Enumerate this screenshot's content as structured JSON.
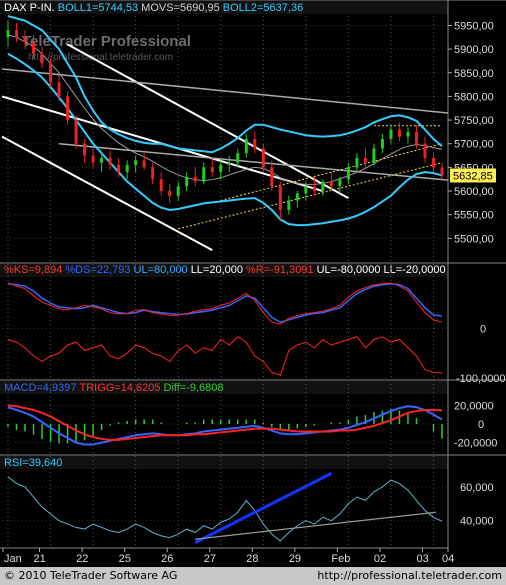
{
  "price_panel": {
    "header": [
      {
        "text": "DAX P-IN.",
        "color": "#ffffff"
      },
      {
        "text": "BOLL1=5744,53",
        "color": "#33ccff"
      },
      {
        "text": "MOVS=5690,95",
        "color": "#d0d0d0"
      },
      {
        "text": "BOLL2=5637,36",
        "color": "#33ccff"
      }
    ],
    "watermark_title": "TeleTrader Professional",
    "watermark_url": "http://professional.teletrader.com",
    "y_ticks": [
      "5950,00",
      "5900,00",
      "5850,00",
      "5800,00",
      "5750,00",
      "5700,00",
      "5650,00",
      "5600,00",
      "5550,00",
      "5500,00"
    ],
    "last_price": "5632,85"
  },
  "stoch_panel": {
    "header": [
      {
        "text": "%KS=9,894",
        "color": "#ff3333"
      },
      {
        "text": "%DS=22,793",
        "color": "#3366ff"
      },
      {
        "text": "UL=80,000",
        "color": "#33aaff"
      },
      {
        "text": "LL=20,000",
        "color": "#ffffff"
      },
      {
        "text": "%R=-91,3091",
        "color": "#ff3333"
      },
      {
        "text": "UL=-80,0000",
        "color": "#ffffff"
      },
      {
        "text": "LL=-20,0000",
        "color": "#ffffff"
      }
    ],
    "y_ticks": [
      "0",
      "-100,0000"
    ]
  },
  "macd_panel": {
    "header": [
      {
        "text": "MACD=4,9397",
        "color": "#3366ff"
      },
      {
        "text": "TRIGG=14,6205",
        "color": "#ff3333"
      },
      {
        "text": "Diff=-9,6808",
        "color": "#33cc33"
      }
    ],
    "y_ticks": [
      "20,0000",
      "0",
      "-20,0000"
    ]
  },
  "rsi_panel": {
    "header": [
      {
        "text": "RSI=39,640",
        "color": "#33ccff"
      }
    ],
    "y_ticks": [
      "60,000",
      "40,000"
    ]
  },
  "x_axis": {
    "ticks": [
      "Jan",
      "21",
      "22",
      "25",
      "26",
      "27",
      "28",
      "29",
      "Feb",
      "02",
      "03",
      "04"
    ]
  },
  "footer": {
    "copyright": "© 2010 TeleTrader Software AG",
    "url": "http://professional.teletrader.com"
  },
  "chart_data": [
    {
      "type": "candlestick",
      "title": "DAX P-IN.",
      "ylim": [
        5450,
        5970
      ],
      "candles": [
        {
          "o": 5925,
          "h": 5960,
          "l": 5905,
          "c": 5940
        },
        {
          "o": 5940,
          "h": 5955,
          "l": 5915,
          "c": 5925
        },
        {
          "o": 5925,
          "h": 5940,
          "l": 5900,
          "c": 5915
        },
        {
          "o": 5915,
          "h": 5930,
          "l": 5880,
          "c": 5890
        },
        {
          "o": 5890,
          "h": 5905,
          "l": 5860,
          "c": 5870
        },
        {
          "o": 5870,
          "h": 5880,
          "l": 5820,
          "c": 5830
        },
        {
          "o": 5830,
          "h": 5845,
          "l": 5790,
          "c": 5800
        },
        {
          "o": 5800,
          "h": 5810,
          "l": 5740,
          "c": 5750
        },
        {
          "o": 5750,
          "h": 5760,
          "l": 5690,
          "c": 5700
        },
        {
          "o": 5700,
          "h": 5710,
          "l": 5660,
          "c": 5675
        },
        {
          "o": 5675,
          "h": 5690,
          "l": 5650,
          "c": 5660
        },
        {
          "o": 5660,
          "h": 5680,
          "l": 5640,
          "c": 5670
        },
        {
          "o": 5670,
          "h": 5685,
          "l": 5645,
          "c": 5655
        },
        {
          "o": 5655,
          "h": 5670,
          "l": 5630,
          "c": 5640
        },
        {
          "o": 5640,
          "h": 5665,
          "l": 5625,
          "c": 5655
        },
        {
          "o": 5655,
          "h": 5675,
          "l": 5640,
          "c": 5665
        },
        {
          "o": 5665,
          "h": 5680,
          "l": 5645,
          "c": 5650
        },
        {
          "o": 5650,
          "h": 5660,
          "l": 5615,
          "c": 5625
        },
        {
          "o": 5625,
          "h": 5640,
          "l": 5590,
          "c": 5600
        },
        {
          "o": 5600,
          "h": 5615,
          "l": 5575,
          "c": 5590
        },
        {
          "o": 5590,
          "h": 5620,
          "l": 5580,
          "c": 5610
        },
        {
          "o": 5610,
          "h": 5640,
          "l": 5600,
          "c": 5630
        },
        {
          "o": 5630,
          "h": 5650,
          "l": 5610,
          "c": 5620
        },
        {
          "o": 5620,
          "h": 5660,
          "l": 5615,
          "c": 5650
        },
        {
          "o": 5650,
          "h": 5670,
          "l": 5630,
          "c": 5640
        },
        {
          "o": 5640,
          "h": 5665,
          "l": 5625,
          "c": 5655
        },
        {
          "o": 5655,
          "h": 5675,
          "l": 5640,
          "c": 5660
        },
        {
          "o": 5660,
          "h": 5690,
          "l": 5650,
          "c": 5680
        },
        {
          "o": 5680,
          "h": 5720,
          "l": 5670,
          "c": 5710
        },
        {
          "o": 5710,
          "h": 5725,
          "l": 5680,
          "c": 5690
        },
        {
          "o": 5690,
          "h": 5700,
          "l": 5640,
          "c": 5650
        },
        {
          "o": 5650,
          "h": 5665,
          "l": 5600,
          "c": 5610
        },
        {
          "o": 5610,
          "h": 5620,
          "l": 5540,
          "c": 5560
        },
        {
          "o": 5560,
          "h": 5590,
          "l": 5550,
          "c": 5580
        },
        {
          "o": 5580,
          "h": 5600,
          "l": 5565,
          "c": 5595
        },
        {
          "o": 5595,
          "h": 5620,
          "l": 5580,
          "c": 5610
        },
        {
          "o": 5610,
          "h": 5630,
          "l": 5590,
          "c": 5600
        },
        {
          "o": 5600,
          "h": 5625,
          "l": 5590,
          "c": 5620
        },
        {
          "o": 5620,
          "h": 5640,
          "l": 5600,
          "c": 5610
        },
        {
          "o": 5610,
          "h": 5630,
          "l": 5595,
          "c": 5625
        },
        {
          "o": 5625,
          "h": 5660,
          "l": 5615,
          "c": 5650
        },
        {
          "o": 5650,
          "h": 5680,
          "l": 5640,
          "c": 5670
        },
        {
          "o": 5670,
          "h": 5690,
          "l": 5650,
          "c": 5660
        },
        {
          "o": 5660,
          "h": 5700,
          "l": 5655,
          "c": 5690
        },
        {
          "o": 5690,
          "h": 5720,
          "l": 5680,
          "c": 5710
        },
        {
          "o": 5710,
          "h": 5740,
          "l": 5700,
          "c": 5730
        },
        {
          "o": 5730,
          "h": 5745,
          "l": 5705,
          "c": 5715
        },
        {
          "o": 5715,
          "h": 5735,
          "l": 5700,
          "c": 5725
        },
        {
          "o": 5725,
          "h": 5740,
          "l": 5690,
          "c": 5700
        },
        {
          "o": 5700,
          "h": 5715,
          "l": 5660,
          "c": 5670
        },
        {
          "o": 5670,
          "h": 5680,
          "l": 5640,
          "c": 5650
        },
        {
          "o": 5650,
          "h": 5660,
          "l": 5625,
          "c": 5633
        }
      ],
      "bollinger_upper": [
        5970,
        5965,
        5960,
        5950,
        5940,
        5920,
        5900,
        5870,
        5840,
        5800,
        5770,
        5745,
        5730,
        5720,
        5712,
        5706,
        5702,
        5700,
        5700,
        5695,
        5690,
        5688,
        5686,
        5684,
        5682,
        5690,
        5700,
        5712,
        5728,
        5740,
        5740,
        5735,
        5730,
        5726,
        5722,
        5718,
        5716,
        5715,
        5716,
        5718,
        5722,
        5728,
        5735,
        5745,
        5752,
        5758,
        5760,
        5756,
        5748,
        5730,
        5710,
        5695
      ],
      "moving_average": [
        5930,
        5925,
        5915,
        5905,
        5890,
        5870,
        5850,
        5825,
        5800,
        5775,
        5752,
        5732,
        5716,
        5702,
        5690,
        5680,
        5672,
        5663,
        5652,
        5642,
        5634,
        5628,
        5624,
        5622,
        5624,
        5628,
        5634,
        5640,
        5646,
        5650,
        5648,
        5640,
        5628,
        5620,
        5616,
        5614,
        5614,
        5616,
        5620,
        5626,
        5632,
        5640,
        5648,
        5658,
        5668,
        5678,
        5688,
        5695,
        5698,
        5696,
        5692,
        5688
      ],
      "bollinger_lower": [
        5890,
        5880,
        5868,
        5855,
        5840,
        5820,
        5798,
        5775,
        5750,
        5725,
        5700,
        5680,
        5660,
        5640,
        5620,
        5605,
        5590,
        5575,
        5565,
        5560,
        5562,
        5566,
        5570,
        5574,
        5576,
        5578,
        5580,
        5582,
        5584,
        5585,
        5575,
        5560,
        5540,
        5530,
        5528,
        5528,
        5530,
        5532,
        5535,
        5538,
        5542,
        5548,
        5556,
        5566,
        5578,
        5590,
        5608,
        5624,
        5636,
        5640,
        5638,
        5633
      ]
    },
    {
      "type": "line",
      "title": "%KS / %DS / %R",
      "ylim": [
        -100,
        100
      ],
      "series": [
        {
          "name": "%DS",
          "values": [
            90,
            88,
            85,
            75,
            60,
            50,
            42,
            40,
            38,
            40,
            45,
            40,
            35,
            30,
            28,
            30,
            35,
            32,
            30,
            28,
            26,
            27,
            30,
            32,
            35,
            40,
            45,
            55,
            65,
            60,
            40,
            20,
            10,
            15,
            20,
            25,
            28,
            30,
            35,
            40,
            55,
            70,
            78,
            85,
            88,
            90,
            88,
            80,
            60,
            40,
            25,
            23
          ]
        },
        {
          "name": "%KS",
          "values": [
            92,
            85,
            80,
            65,
            52,
            45,
            38,
            36,
            40,
            45,
            42,
            38,
            30,
            27,
            28,
            35,
            36,
            30,
            27,
            24,
            25,
            28,
            33,
            36,
            38,
            45,
            50,
            60,
            70,
            55,
            30,
            10,
            6,
            18,
            24,
            28,
            30,
            33,
            38,
            45,
            62,
            75,
            82,
            88,
            90,
            92,
            85,
            75,
            52,
            30,
            15,
            10
          ]
        },
        {
          "name": "%R",
          "values": [
            -30,
            -35,
            -45,
            -60,
            -70,
            -60,
            -55,
            -40,
            -35,
            -50,
            -45,
            -40,
            -60,
            -65,
            -55,
            -40,
            -45,
            -55,
            -60,
            -70,
            -50,
            -40,
            -55,
            -45,
            -50,
            -30,
            -40,
            -25,
            -35,
            -60,
            -70,
            -90,
            -95,
            -50,
            -40,
            -35,
            -45,
            -30,
            -40,
            -35,
            -30,
            -25,
            -45,
            -30,
            -25,
            -35,
            -30,
            -45,
            -60,
            -85,
            -90,
            -91
          ]
        }
      ]
    },
    {
      "type": "line",
      "title": "MACD",
      "ylim": [
        -30,
        30
      ],
      "series": [
        {
          "name": "MACD",
          "values": [
            18,
            15,
            12,
            8,
            2,
            -4,
            -10,
            -15,
            -20,
            -22,
            -22,
            -20,
            -18,
            -16,
            -14,
            -12,
            -11,
            -10,
            -11,
            -12,
            -12,
            -11,
            -10,
            -8,
            -7,
            -6,
            -5,
            -4,
            -3,
            -2,
            -4,
            -7,
            -10,
            -11,
            -11,
            -10,
            -9,
            -8,
            -7,
            -6,
            -4,
            -1,
            2,
            6,
            10,
            14,
            17,
            19,
            18,
            15,
            10,
            5
          ]
        },
        {
          "name": "TRIGG",
          "values": [
            20,
            19,
            17,
            15,
            12,
            8,
            3,
            -2,
            -7,
            -11,
            -14,
            -16,
            -17,
            -17,
            -16,
            -15,
            -14,
            -13,
            -12,
            -12,
            -12,
            -12,
            -11,
            -11,
            -10,
            -9,
            -8,
            -7,
            -6,
            -5,
            -5,
            -5,
            -6,
            -7,
            -8,
            -8,
            -8,
            -8,
            -8,
            -7,
            -7,
            -6,
            -4,
            -2,
            1,
            4,
            8,
            12,
            14,
            15,
            15,
            14.6
          ]
        },
        {
          "name": "Diff",
          "values": [
            -2,
            -4,
            -5,
            -7,
            -10,
            -12,
            -13,
            -13,
            -13,
            -11,
            -8,
            -4,
            -1,
            1,
            2,
            3,
            3,
            3,
            1,
            0,
            0,
            1,
            1,
            3,
            3,
            3,
            3,
            3,
            3,
            3,
            1,
            -2,
            -4,
            -4,
            -3,
            -2,
            -1,
            0,
            1,
            1,
            3,
            5,
            6,
            8,
            9,
            10,
            9,
            7,
            4,
            0,
            -5,
            -9.7
          ]
        }
      ]
    },
    {
      "type": "line",
      "title": "RSI",
      "ylim": [
        25,
        70
      ],
      "series": [
        {
          "name": "RSI",
          "values": [
            66,
            62,
            60,
            54,
            48,
            44,
            40,
            38,
            36,
            35,
            38,
            36,
            34,
            33,
            35,
            38,
            36,
            33,
            31,
            30,
            32,
            35,
            33,
            37,
            35,
            39,
            41,
            45,
            52,
            46,
            38,
            32,
            28,
            33,
            37,
            40,
            38,
            42,
            40,
            44,
            50,
            54,
            52,
            57,
            60,
            64,
            62,
            58,
            52,
            46,
            42,
            39.6
          ]
        }
      ]
    }
  ]
}
